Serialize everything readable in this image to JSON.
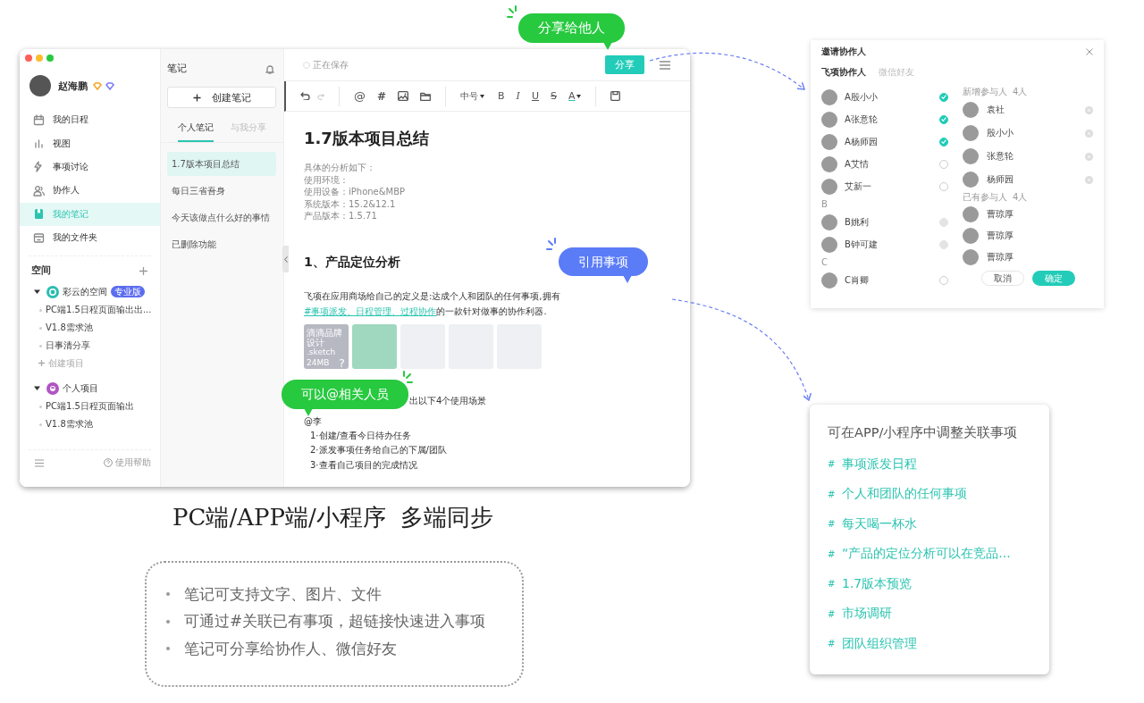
{
  "app_window": {
    "sidebar": {
      "user": {
        "name": "赵海鹏"
      },
      "nav": [
        {
          "kind": "calendar",
          "label": "我的日程",
          "selected": false
        },
        {
          "kind": "chart",
          "label": "视图",
          "selected": false
        },
        {
          "kind": "discussion",
          "label": "事项讨论",
          "selected": false
        },
        {
          "kind": "people",
          "label": "协作人",
          "selected": false
        },
        {
          "kind": "note",
          "label": "我的笔记",
          "selected": true
        },
        {
          "kind": "folder",
          "label": "我的文件夹",
          "selected": false
        }
      ],
      "spaces_title": "空间",
      "spaces": [
        {
          "kind": "team",
          "name": "彩云的空间",
          "badge": "专业版",
          "expanded": true,
          "children": [
            {
              "label": "PC端1.5日程页面输出出..."
            },
            {
              "label": "V1.8需求池"
            },
            {
              "label": "日事清分享"
            }
          ],
          "add_label": "创建项目"
        },
        {
          "kind": "personal",
          "name": "个人项目",
          "expanded": true,
          "children": [
            {
              "label": "PC端1.5日程页面输出"
            },
            {
              "label": "V1.8需求池"
            }
          ]
        }
      ],
      "help": "使用帮助"
    },
    "notes_panel": {
      "title": "笔记",
      "create_button": "创建笔记",
      "tabs": [
        {
          "label": "个人笔记",
          "selected": true
        },
        {
          "label": "与我分享",
          "selected": false
        }
      ],
      "notes": [
        {
          "title": "1.7版本项目总结",
          "selected": true
        },
        {
          "title": "每日三省吾身",
          "selected": false
        },
        {
          "title": "今天该做点什么好的事情",
          "selected": false
        },
        {
          "title": "已删除功能",
          "selected": false
        }
      ]
    },
    "editor": {
      "save_status": "正在保存",
      "share_button": "分享",
      "inserts": [
        {
          "kind": "mention",
          "label": "@"
        },
        {
          "kind": "tag",
          "label": "#"
        }
      ],
      "font_size": "中号",
      "formats": [
        {
          "kind": "bold",
          "label": "B"
        },
        {
          "kind": "italic",
          "label": "I"
        },
        {
          "kind": "underline",
          "label": "U"
        },
        {
          "kind": "strike",
          "label": "S"
        },
        {
          "kind": "color",
          "label": "A"
        }
      ],
      "title": "1.7版本项目总结",
      "meta_lines": [
        "具体的分析如下：",
        "使用环境：",
        "使用设备：iPhone&MBP",
        "系统版本：15.2&12.1",
        "产品版本：1.5.71"
      ],
      "heading": "1、产品定位分析",
      "paragraph_start": "飞项在应用商场给自己的定义是:达成个人和团队的任何事项,拥有",
      "paragraph_link": "#事项派发、日程管理、过程协作",
      "paragraph_end": "的一款针对做事的协作利器.",
      "attachments": [
        {
          "kind": "file",
          "name": "滴滴品牌设计",
          "ext": ".sketch",
          "size": "24MB",
          "mark": "?"
        },
        {
          "kind": "image"
        },
        {
          "kind": "image"
        },
        {
          "kind": "image"
        },
        {
          "kind": "image"
        }
      ],
      "partial_line": "出以下4个使用场景",
      "mention": "@李",
      "list": [
        "1·创建/查看今日待办任务",
        "2·派发事项任务给自己的下属/团队",
        "3·查看自己项目的完成情况"
      ]
    }
  },
  "callouts": [
    {
      "kind": "share",
      "text": "分享给他人",
      "color": "#27c93f"
    },
    {
      "kind": "reference",
      "text": "引用事项",
      "color": "#5b7cf7"
    },
    {
      "kind": "mention",
      "text": "可以@相关人员",
      "color": "#27c93f"
    }
  ],
  "invite_dialog": {
    "title": "邀请协作人",
    "tabs": [
      {
        "label": "飞项协作人",
        "selected": true
      },
      {
        "label": "微信好友",
        "selected": false
      }
    ],
    "contacts": [
      {
        "kind": "contact",
        "name": "A殷小小",
        "checked": true,
        "disabled": false
      },
      {
        "kind": "contact",
        "name": "A张意轮",
        "checked": true,
        "disabled": false
      },
      {
        "kind": "contact",
        "name": "A杨师园",
        "checked": true,
        "disabled": false
      },
      {
        "kind": "contact",
        "name": "A艾情",
        "checked": false,
        "disabled": false
      },
      {
        "kind": "contact",
        "name": "艾新一",
        "checked": false,
        "disabled": false
      },
      {
        "kind": "letter",
        "name": "B"
      },
      {
        "kind": "contact",
        "name": "B姚利",
        "checked": false,
        "disabled": true
      },
      {
        "kind": "contact",
        "name": "B钟可建",
        "checked": false,
        "disabled": true
      },
      {
        "kind": "letter",
        "name": "C"
      },
      {
        "kind": "contact",
        "name": "C肖卿",
        "checked": false,
        "disabled": false
      }
    ],
    "new_title": "新增参与人",
    "new_count": "4人",
    "new_members": [
      "袁社",
      "殷小小",
      "张意轮",
      "杨师园"
    ],
    "existing_title": "已有参与人",
    "existing_count": "4人",
    "existing_members": [
      "曹琼厚",
      "曹琼厚",
      "曹琼厚"
    ],
    "cancel_button": "取消",
    "confirm_button": "确定"
  },
  "linked_items_card": {
    "title": "可在APP/小程序中调整关联事项",
    "items": [
      {
        "hash": "#",
        "text": "事项派发日程"
      },
      {
        "hash": "#",
        "text": "个人和团队的任何事项"
      },
      {
        "hash": "#",
        "text": "每天喝一杯水"
      },
      {
        "hash": "#",
        "text": "“产品的定位分析可以在竞品..."
      },
      {
        "hash": "#",
        "text": "1.7版本预览"
      },
      {
        "hash": "#",
        "text": "市场调研"
      },
      {
        "hash": "#",
        "text": "团队组织管理"
      }
    ]
  },
  "caption": "PC端/APP端/小程序  多端同步",
  "features": [
    "笔记可支持文字、图片、文件",
    "可通过#关联已有事项，超链接快速进入事项",
    "笔记可分享给协作人、微信好友"
  ]
}
